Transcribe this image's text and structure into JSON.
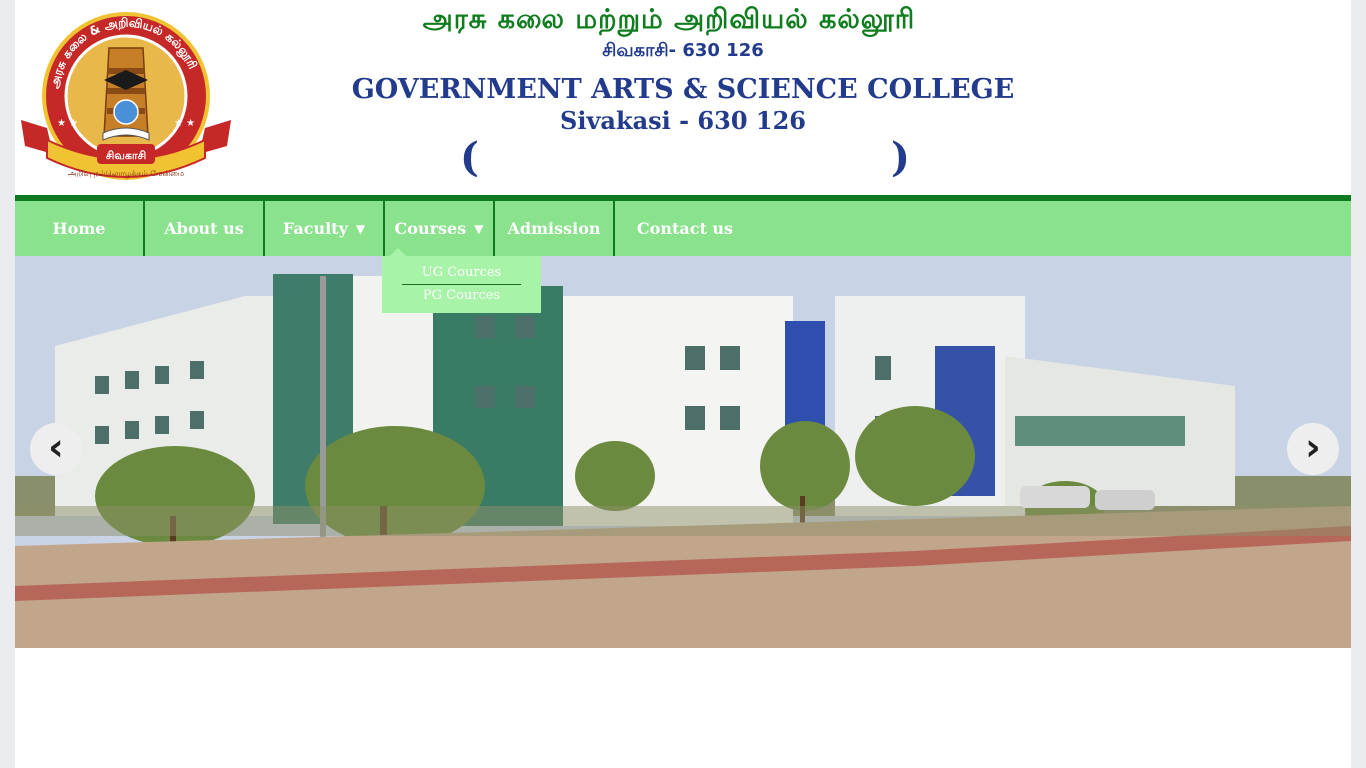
{
  "header": {
    "tamil_title": "அரசு  கலை  மற்றும்  அறிவியல்  கல்லூரி",
    "tamil_subtitle": "சிவகாசி- 630 126",
    "english_title": "GOVERNMENT ARTS  & SCIENCE COLLEGE",
    "english_subtitle": "Sivakasi - 630 126",
    "paren_left": "(",
    "paren_right": ")"
  },
  "logo": {
    "ring_text": "அரசு கலை & அறிவியல் கல்லூரி",
    "center_text": "சிவகாசி",
    "motto": "அறிவு  நல்லொழுக்கம்  மேன்மை"
  },
  "nav": {
    "home": "Home",
    "about": "About us",
    "faculty": "Faculty",
    "courses": "Courses",
    "admission": "Admission",
    "contact": "Contact us",
    "caret": "▼"
  },
  "courses_dropdown": {
    "ug": "UG Cources",
    "pg": "PG Cources"
  },
  "slider": {
    "prev": "‹",
    "next": "›"
  },
  "colors": {
    "nav_bg": "#8be28d",
    "nav_border": "#0e7a1f",
    "title_blue": "#233b8c",
    "tamil_green": "#0f7d1e",
    "dropdown_bg": "#a7f3a7"
  }
}
